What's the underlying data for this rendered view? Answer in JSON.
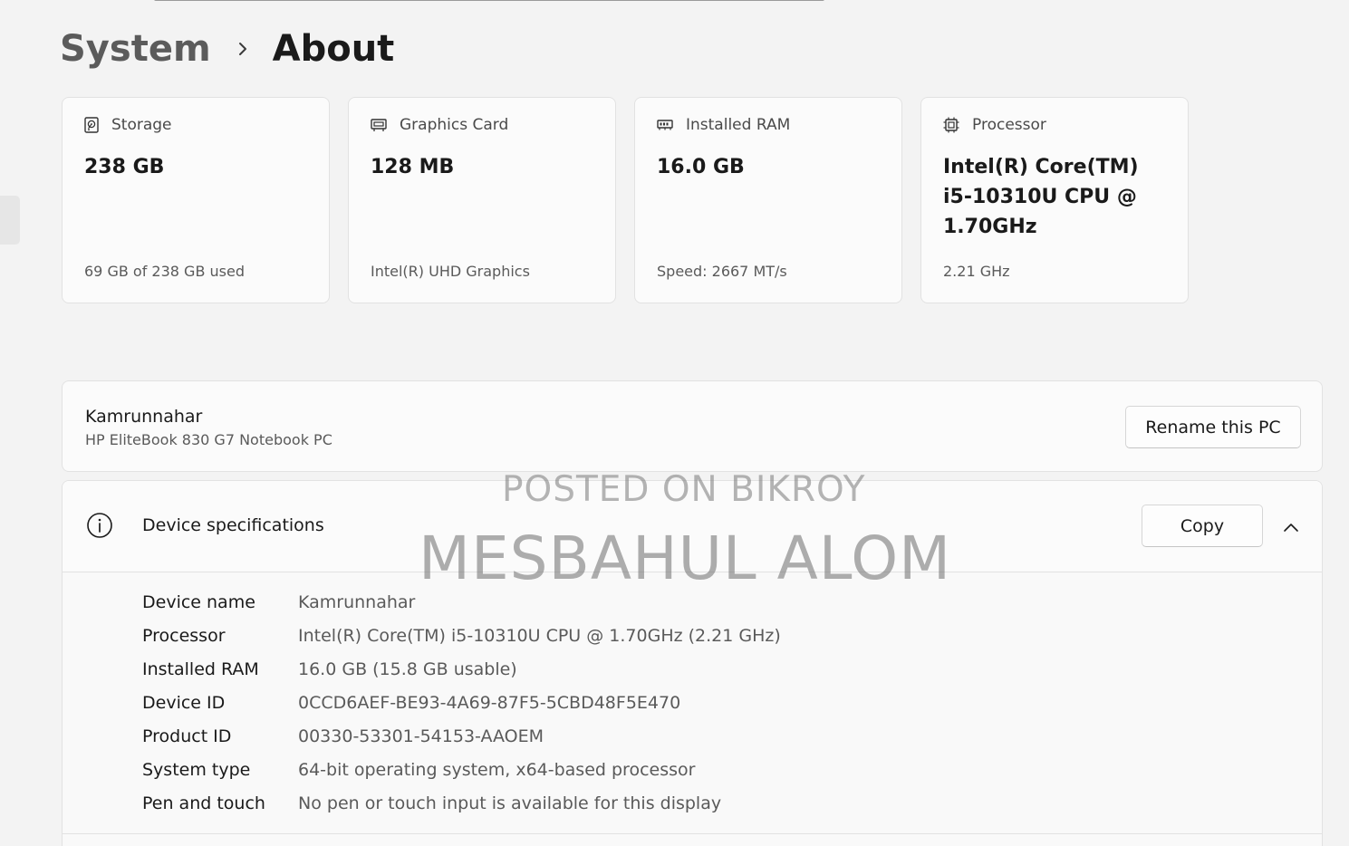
{
  "breadcrumb": {
    "parent": "System",
    "current": "About"
  },
  "cards": [
    {
      "title": "Storage",
      "value": "238 GB",
      "sub": "69 GB of 238 GB used",
      "icon": "hard-drive-icon"
    },
    {
      "title": "Graphics Card",
      "value": "128 MB",
      "sub": "Intel(R) UHD Graphics",
      "icon": "graphics-card-icon"
    },
    {
      "title": "Installed RAM",
      "value": "16.0 GB",
      "sub": "Speed: 2667 MT/s",
      "icon": "ram-icon"
    },
    {
      "title": "Processor",
      "value": "Intel(R) Core(TM) i5-10310U CPU @ 1.70GHz",
      "sub": "2.21 GHz",
      "icon": "processor-icon"
    }
  ],
  "pc": {
    "name": "Kamrunnahar",
    "model": "HP EliteBook 830 G7 Notebook PC",
    "rename_label": "Rename this PC"
  },
  "specs": {
    "title": "Device specifications",
    "copy_label": "Copy",
    "rows": [
      {
        "label": "Device name",
        "value": "Kamrunnahar"
      },
      {
        "label": "Processor",
        "value": "Intel(R) Core(TM) i5-10310U CPU @ 1.70GHz (2.21 GHz)"
      },
      {
        "label": "Installed RAM",
        "value": "16.0 GB (15.8 GB usable)"
      },
      {
        "label": "Device ID",
        "value": "0CCD6AEF-BE93-4A69-87F5-5CBD48F5E470"
      },
      {
        "label": "Product ID",
        "value": "00330-53301-54153-AAOEM"
      },
      {
        "label": "System type",
        "value": "64-bit operating system, x64-based processor"
      },
      {
        "label": "Pen and touch",
        "value": "No pen or touch input is available for this display"
      }
    ]
  },
  "watermark": {
    "line1": "POSTED ON BIKROY",
    "line2": "MESBAHUL ALOM"
  }
}
